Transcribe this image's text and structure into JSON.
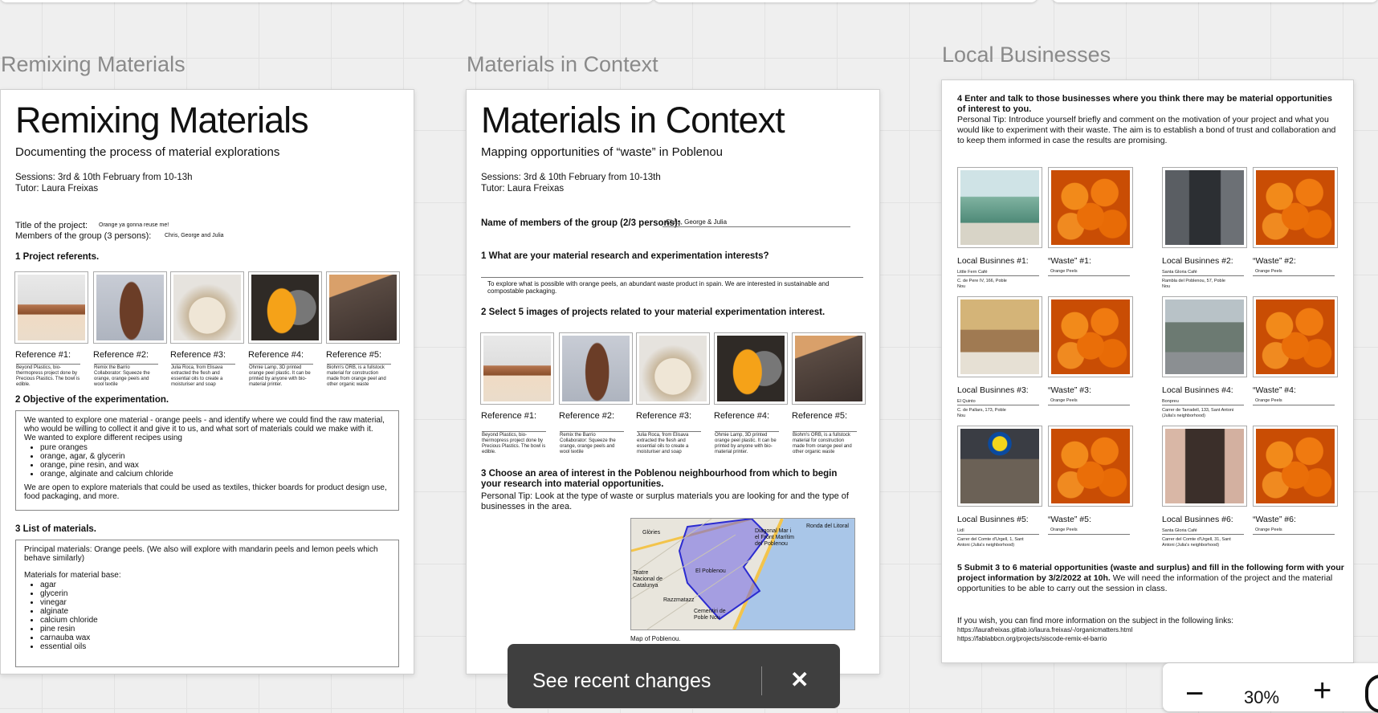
{
  "toast": {
    "text": "See recent changes",
    "close": "✕"
  },
  "zoom": {
    "minus": "−",
    "value": "30%",
    "plus": "+"
  },
  "frames": [
    {
      "label": "Remixing Materials"
    },
    {
      "label": "Materials in Context"
    },
    {
      "label": "Local Businesses"
    }
  ],
  "doc1": {
    "title": "Remixing Materials",
    "subtitle": "Documenting the process of material explorations",
    "sessions": "Sessions: 3rd & 10th February from 10-13h",
    "tutor": "Tutor: Laura Freixas",
    "project_title_label": "Title of the project:",
    "project_title_value": "Orange ya gonna reuse me!",
    "members_label": "Members of the group (3 persons):",
    "members_value": "Chris, George and Julia",
    "sec1": "1 Project referents.",
    "refs": [
      {
        "label": "Reference #1:",
        "desc": "Beyond Plastics, bio-thermopress project done by Precious Plastics. The bowl is edible."
      },
      {
        "label": "Reference #2:",
        "desc": "Remix the Barrio Collaborator: Squeeze the orange, orange peels and wool textile"
      },
      {
        "label": "Reference #3:",
        "desc": "Julia Roca, from Elisava extracted the flesh and essential oils to create a moisturiser and soap"
      },
      {
        "label": "Reference #4:",
        "desc": "Ohmie Lamp, 3D printed orange peel plastic. It can be printed by anyone with bio-material printer."
      },
      {
        "label": "Reference #5:",
        "desc": "Biohm's ORB, is a fullstock material for construction made from orange peel and other organic waste"
      }
    ],
    "sec2": "2 Objective of the experimentation.",
    "obj_p1": "We wanted to explore one material - orange peels - and identify where we could find the raw material, who would be willing to collect it and give it to us, and what sort of materials could we make with it.",
    "obj_p2": "We wanted to explore different recipes using",
    "obj_items": [
      "pure oranges",
      "orange, agar, & glycerin",
      "orange, pine resin, and wax",
      "orange, alginate and calcium chloride"
    ],
    "obj_p3": "We are open to explore materials that could be used as textiles, thicker boards for product design use, food packaging, and more.",
    "sec3": "3 List of materials.",
    "mat_p1": "Principal materials: Orange peels. (We also will explore with mandarin peels and lemon peels which behave similarly)",
    "mat_p2": "Materials for material base:",
    "mat_items": [
      "agar",
      "glycerin",
      "vinegar",
      "alginate",
      "calcium chloride",
      "pine resin",
      "carnauba wax",
      "essential oils"
    ]
  },
  "doc2": {
    "title": "Materials in Context",
    "subtitle": "Mapping opportunities of “waste” in Poblenou",
    "sessions": "Sessions: 3rd & 10th February from 10-13th",
    "tutor": "Tutor: Laura Freixas",
    "members_label": "Name of members of the group (2/3 persons):",
    "members_value": "Chris, George & Julia",
    "q1": "1 What are your material research and experimentation interests?",
    "a1": "To explore what is possible with orange peels, an abundant waste product in spain. We are interested in sustainable and compostable packaging.",
    "q2": "2 Select 5 images of projects related to your material experimentation interest.",
    "refs": [
      {
        "label": "Reference #1:",
        "desc": "Beyond Plastics, bio-thermopress project done by Precious Plastics. The bowl is edible."
      },
      {
        "label": "Reference #2:",
        "desc": "Remix the Barrio Collaborator: Squeeze the orange, orange peels and wool textile"
      },
      {
        "label": "Reference #3:",
        "desc": "Julia Roca, from Elisava extracted the flesh and essential oils to create a moisturiser and soap"
      },
      {
        "label": "Reference #4:",
        "desc": "Ohmie Lamp, 3D printed orange peel plastic. It can be printed by anyone with bio-material printer."
      },
      {
        "label": "Reference #5:",
        "desc": "Biohm's ORB, is a fullstock material for construction made from orange peel and other organic waste"
      }
    ],
    "q3": "3 Choose an area of interest in the Poblenou neighbourhood from which to begin your research into material opportunities.",
    "tip": "Personal Tip: Look at the type of waste or surplus materials you are looking for and the type of businesses in the area.",
    "map_labels": {
      "a": "Glòries",
      "b": "Diagonal Mar i el Front Marítim del Poblenou",
      "c": "El Poblenou",
      "d": "Teatre Nacional de Catalunya",
      "e": "Razzmatazz",
      "f": "Cementiri de Poble Nou",
      "g": "Ronda del Litoral"
    },
    "map_caption": "Map of Poblenou."
  },
  "doc3": {
    "step4_title": "4 Enter and talk to those businesses where you think there may be material opportunities of interest to you.",
    "step4_tip": "Personal Tip: Introduce yourself briefly and comment on the motivation of your project and what you would like to experiment with their waste. The aim is to establish a bond of trust and collaboration and to keep them informed in case the results are promising.",
    "businesses": [
      {
        "label": "Local Businnes #1:",
        "name": "Little Fern Café",
        "addr": "C. de Pere IV, 166, Poble Nou",
        "waste_label": "“Waste” #1:",
        "waste": "Orange Peels"
      },
      {
        "label": "Local Businnes #2:",
        "name": "Santa Gloria Café",
        "addr": "Rambla del Poblenou, 57, Poble Nou",
        "waste_label": "“Waste” #2:",
        "waste": "Orange Peels"
      },
      {
        "label": "Local Businnes #3:",
        "name": "El Quinto",
        "addr": "C. de Pallars, 173, Poble Nou",
        "waste_label": "“Waste” #3:",
        "waste": "Orange Peels"
      },
      {
        "label": "Local Businnes #4:",
        "name": "Bonpreu",
        "addr": "Carrer de Tarradell, 133, Sant Antoni (Julia's neighborhood)",
        "waste_label": "“Waste” #4:",
        "waste": "Orange Peels"
      },
      {
        "label": "Local Businnes #5:",
        "name": "Lidl",
        "addr": "Carrer del Comte d'Urgell, 1, Sant Antoni (Julia's neighborhood)",
        "waste_label": "“Waste” #5:",
        "waste": "Orange Peels"
      },
      {
        "label": "Local Businnes #6:",
        "name": "Santa Gloria Café",
        "addr": "Carrer del Comte d'Urgell, 31, Sant Antoni (Julia's neighborhood)",
        "waste_label": "“Waste” #6:",
        "waste": "Orange Peels"
      }
    ],
    "step5_bold": "5 Submit 3 to 6 material opportunities (waste and surplus) and fill in the following form with your project information by 3/2/2022 at 10h.",
    "step5_rest": " We will need the information of the project and the material opportunities to be able to carry out the session in class.",
    "more_info": "If you wish, you can find more information on the subject in the following links:",
    "link1": "https://laurafreixas.gitlab.io/laura.freixas/-/organicmatters.html",
    "link2": "https://fablabbcn.org/projects/siscode-remix-el-barrio"
  }
}
